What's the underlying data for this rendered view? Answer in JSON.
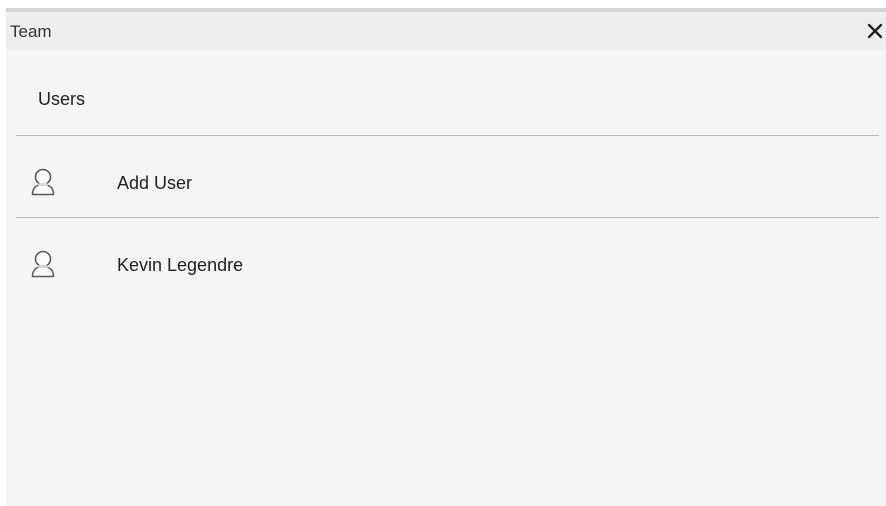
{
  "panel": {
    "title": "Team",
    "close_icon": "close-icon"
  },
  "users_section": {
    "title": "Users",
    "items": [
      {
        "label": "Add User",
        "icon": "user-icon"
      },
      {
        "label": "Kevin Legendre",
        "icon": "user-icon"
      }
    ]
  },
  "colors": {
    "panel_background": "#f5f5f5",
    "titlebar_background": "#eeeeee",
    "divider": "#b8b8b8",
    "text": "#222222"
  }
}
